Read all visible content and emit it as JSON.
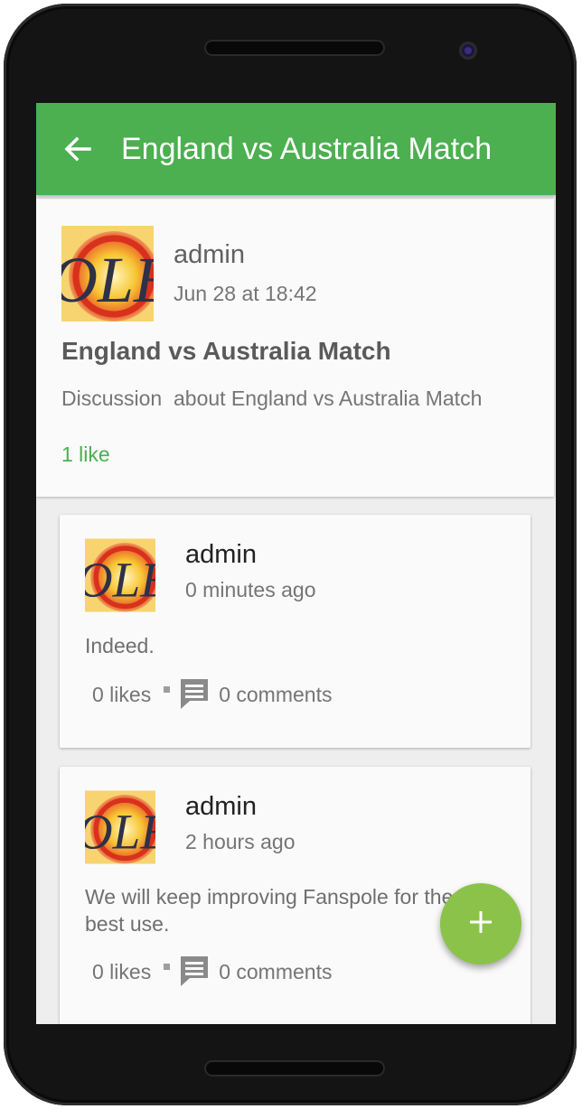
{
  "appbar": {
    "title": "England vs Australia Match",
    "back_icon": "arrow-back-icon",
    "color": "#4caf50"
  },
  "post": {
    "author": "admin",
    "date": "Jun 28 at 18:42",
    "title": "England vs Australia Match",
    "description": "Discussion  about England vs Australia Match",
    "likes": "1 like",
    "avatar_icon": "fanspole-logo-avatar"
  },
  "comments": [
    {
      "author": "admin",
      "time": "0 minutes ago",
      "text": "Indeed.",
      "likes": "0 likes",
      "comments": "0 comments"
    },
    {
      "author": "admin",
      "time": "2 hours ago",
      "text": "We will keep improving Fanspole for the best use.",
      "likes": "0 likes",
      "comments": "0 comments"
    }
  ],
  "fab": {
    "icon": "plus-icon",
    "color": "#8bc34a"
  }
}
